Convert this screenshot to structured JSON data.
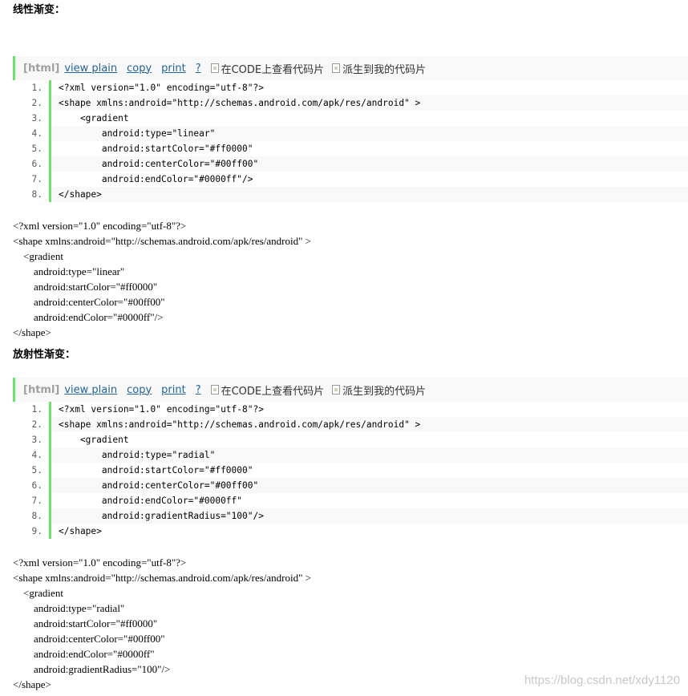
{
  "section1": {
    "heading": "线性渐变：",
    "toolbar": {
      "lang": "[html]",
      "view_plain": "view plain",
      "copy": "copy",
      "print": "print",
      "help": "?",
      "img1": "在CODE上查看代码片",
      "img2": "派生到我的代码片"
    },
    "numbers": [
      "1.",
      "2.",
      "3.",
      "4.",
      "5.",
      "6.",
      "7.",
      "8."
    ],
    "lines": [
      "<?xml version=\"1.0\" encoding=\"utf-8\"?>",
      "<shape xmlns:android=\"http://schemas.android.com/apk/res/android\" >",
      "    <gradient",
      "        android:type=\"linear\"",
      "        android:startColor=\"#ff0000\"",
      "        android:centerColor=\"#00ff00\"",
      "        android:endColor=\"#0000ff\"/>",
      "</shape>"
    ],
    "plain": [
      "<?xml version=\"1.0\" encoding=\"utf-8\"?>",
      "<shape xmlns:android=\"http://schemas.android.com/apk/res/android\" >",
      "    <gradient",
      "        android:type=\"linear\"",
      "        android:startColor=\"#ff0000\"",
      "        android:centerColor=\"#00ff00\"",
      "        android:endColor=\"#0000ff\"/>",
      "</shape>"
    ]
  },
  "section2": {
    "heading": "放射性渐变：",
    "toolbar": {
      "lang": "[html]",
      "view_plain": "view plain",
      "copy": "copy",
      "print": "print",
      "help": "?",
      "img1": "在CODE上查看代码片",
      "img2": "派生到我的代码片"
    },
    "numbers": [
      "1.",
      "2.",
      "3.",
      "4.",
      "5.",
      "6.",
      "7.",
      "8.",
      "9."
    ],
    "lines": [
      "<?xml version=\"1.0\" encoding=\"utf-8\"?>",
      "<shape xmlns:android=\"http://schemas.android.com/apk/res/android\" >",
      "    <gradient",
      "        android:type=\"radial\"",
      "        android:startColor=\"#ff0000\"",
      "        android:centerColor=\"#00ff00\"",
      "        android:endColor=\"#0000ff\"",
      "        android:gradientRadius=\"100\"/>",
      "</shape>"
    ],
    "plain": [
      "<?xml version=\"1.0\" encoding=\"utf-8\"?>",
      "<shape xmlns:android=\"http://schemas.android.com/apk/res/android\" >",
      "    <gradient",
      "        android:type=\"radial\"",
      "        android:startColor=\"#ff0000\"",
      "        android:centerColor=\"#00ff00\"",
      "        android:endColor=\"#0000ff\"",
      "        android:gradientRadius=\"100\"/>",
      "</shape>"
    ]
  },
  "watermark": "https://blog.csdn.net/xdy1120",
  "colors": {
    "accent_bar": "#6ce26c",
    "link": "#236497",
    "stripe": "#f8f8f8"
  }
}
